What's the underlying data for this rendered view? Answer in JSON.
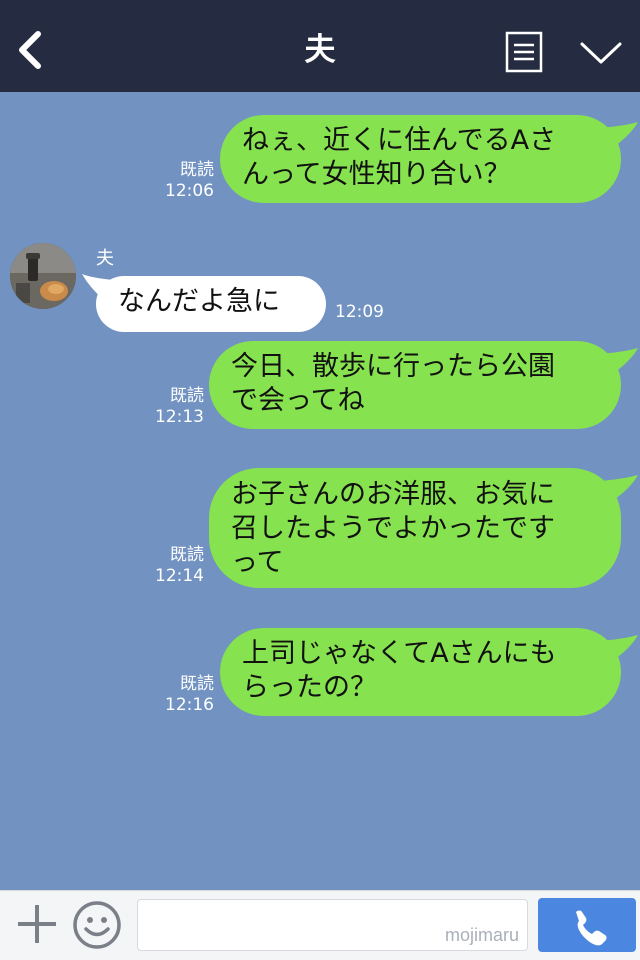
{
  "header": {
    "title": "夫",
    "icons": {
      "back": "chevron-left-icon",
      "menu": "menu-list-icon",
      "collapse": "chevron-down-icon"
    }
  },
  "chat": {
    "sender_name": "夫",
    "messages": [
      {
        "dir": "out",
        "line1": "ねぇ、近くに住んでるAさ",
        "line2": "んって女性知り合い？",
        "read": "既読",
        "time": "12:06"
      },
      {
        "dir": "in",
        "line1": "なんだよ急に",
        "time": "12:09"
      },
      {
        "dir": "out",
        "line1": "今日、散歩に行ったら公園",
        "line2": "で会ってね",
        "read": "既読",
        "time": "12:13"
      },
      {
        "dir": "out",
        "line1": "お子さんのお洋服、お気に",
        "line2": "召したようでよかったです",
        "line3": "って",
        "read": "既読",
        "time": "12:14"
      },
      {
        "dir": "out",
        "line1": "上司じゃなくてAさんにも",
        "line2": "らったの？",
        "read": "既読",
        "time": "12:16"
      }
    ]
  },
  "footer": {
    "input_value": "",
    "watermark": "mojimaru",
    "icons": {
      "add": "plus-icon",
      "emoji": "smiley-icon",
      "call": "phone-icon"
    }
  },
  "colors": {
    "header_bg": "#252c41",
    "chat_bg": "#7293c2",
    "outgoing_bubble": "#86e24e",
    "incoming_bubble": "#ffffff",
    "call_button": "#4b86e0"
  }
}
